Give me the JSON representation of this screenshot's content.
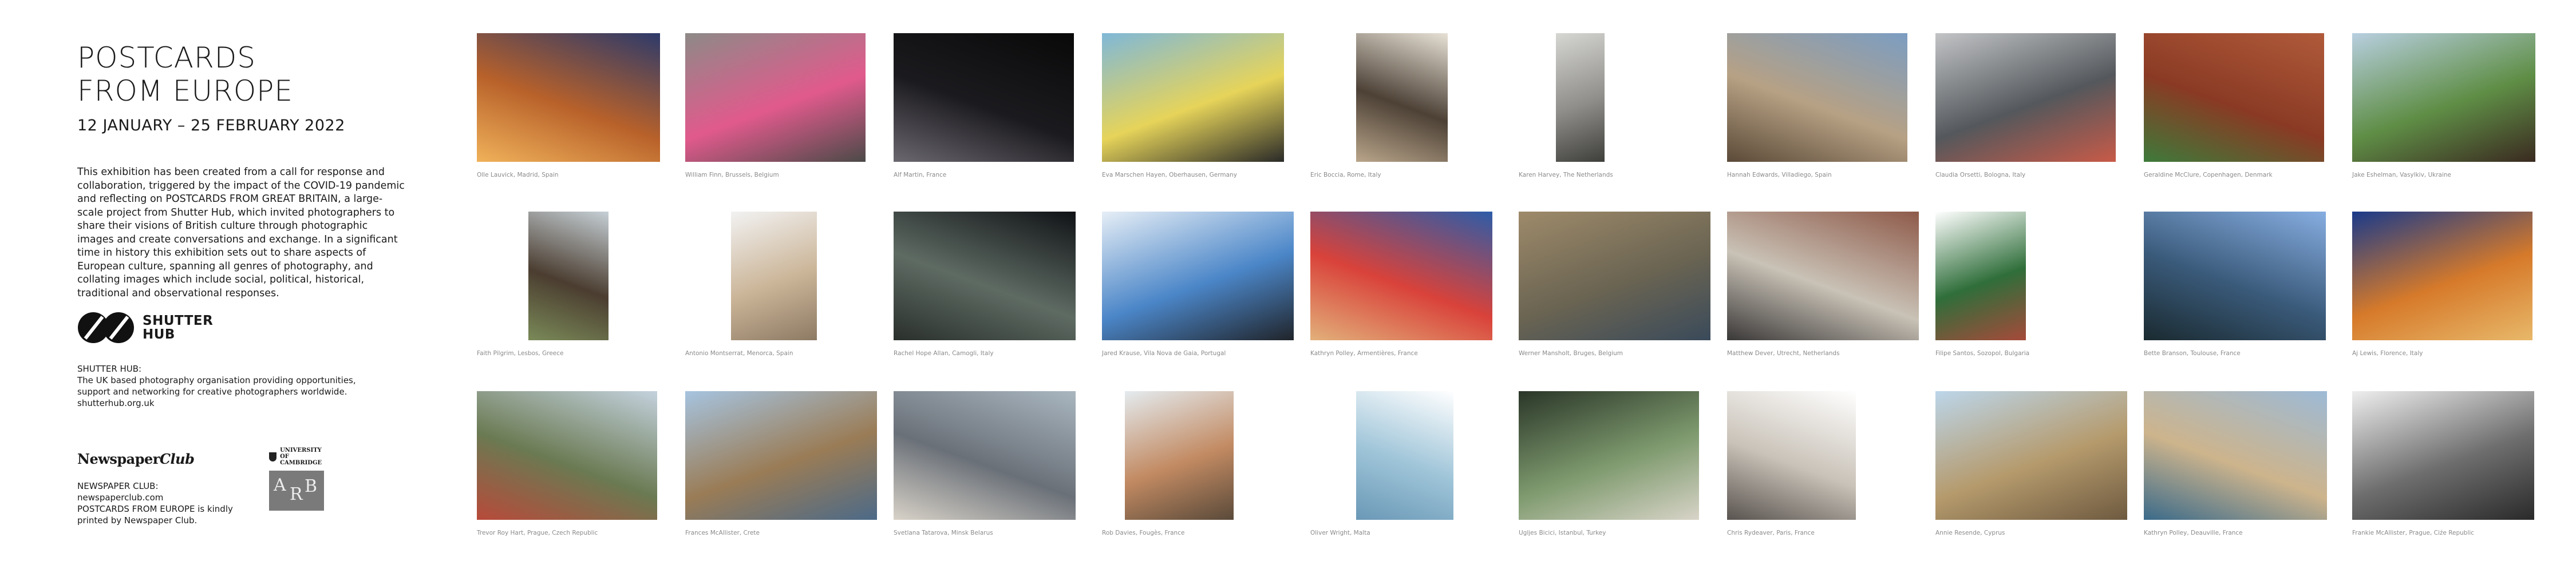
{
  "exhibition": {
    "title_line1": "POSTCARDS",
    "title_line2": "FROM EUROPE",
    "dates": "12 JANUARY – 25 FEBRUARY 2022",
    "intro": "This exhibition has been created from a call for response and collaboration, triggered by the impact of the COVID-19 pandemic and reflecting on POSTCARDS FROM GREAT BRITAIN, a large-scale project from Shutter Hub, which invited photographers to share their visions of British culture through photographic images and create conversations and exchange. In a significant time in history this exhibition sets out to share aspects of European culture, spanning all genres of photography, and collating images which include social, political, historical, traditional and observational responses."
  },
  "shutter_hub": {
    "logo_line1": "SHUTTER",
    "logo_line2": "HUB",
    "heading": "SHUTTER HUB:",
    "desc1": "The UK based photography organisation providing opportunities,",
    "desc2": "support and networking for creative photographers worldwide.",
    "url": "shutterhub.org.uk"
  },
  "newspaper_club": {
    "logo_a": "Newspaper",
    "logo_b": "Club",
    "heading": "NEWSPAPER CLUB:",
    "url": "newspaperclub.com",
    "credit1": "POSTCARDS FROM EUROPE is kindly",
    "credit2": "printed by Newspaper Club."
  },
  "cambridge": {
    "line1": "UNIVERSITY OF",
    "line2": "CAMBRIDGE",
    "arb_a": "A",
    "arb_r": "R",
    "arb_b": "B"
  },
  "photos": [
    {
      "caption": "Olle Lauvick, Madrid, Spain",
      "colors": [
        "#2d3a6a",
        "#b8612a",
        "#f0b25a"
      ]
    },
    {
      "caption": "William Finn, Brussels, Belgium",
      "colors": [
        "#8d8a88",
        "#e15a8c",
        "#4b4a48"
      ]
    },
    {
      "caption": "Alf Martin, France",
      "colors": [
        "#090909",
        "#1b1a1e",
        "#6b6870"
      ]
    },
    {
      "caption": "Eva Marschen Hayen, Oberhausen, Germany",
      "colors": [
        "#7fb8d8",
        "#e6d45a",
        "#2a2a28"
      ]
    },
    {
      "caption": "Eric Boccia, Rome, Italy",
      "colors": [
        "#e8e2d6",
        "#4d4136",
        "#b9a58a"
      ]
    },
    {
      "caption": "Karen Harvey, The Netherlands",
      "colors": [
        "#d6d6d2",
        "#8f8e8a",
        "#3e3e3b"
      ]
    },
    {
      "caption": "Hannah Edwards, Villadiego, Spain",
      "colors": [
        "#7b9dc2",
        "#b7a184",
        "#5b4a38"
      ]
    },
    {
      "caption": "Claudia Orsetti, Bologna, Italy",
      "colors": [
        "#c2c4c6",
        "#54585c",
        "#c85a48"
      ]
    },
    {
      "caption": "Geraldine McClure, Copenhagen, Denmark",
      "colors": [
        "#b05a3a",
        "#8a3a24",
        "#3e7a3a"
      ]
    },
    {
      "caption": "Jake Eshelman, Vasylkiv, Ukraine",
      "colors": [
        "#b8cfe0",
        "#5f8e46",
        "#3a2a20"
      ]
    },
    {
      "caption": "Faith Pilgrim, Lesbos, Greece",
      "colors": [
        "#c6d0d6",
        "#4b3d30",
        "#7a8a58"
      ]
    },
    {
      "caption": "Antonio Montserrat, Menorca, Spain",
      "colors": [
        "#f2f2f2",
        "#cbb598",
        "#8d7a64"
      ]
    },
    {
      "caption": "Rachel Hope Allan, Camogli, Italy",
      "colors": [
        "#101216",
        "#5e6b63",
        "#2a302c"
      ]
    },
    {
      "caption": "Jared Krause, Vila Nova de Gaia, Portugal",
      "colors": [
        "#e6eef6",
        "#4b86c8",
        "#20242a"
      ]
    },
    {
      "caption": "Kathryn Polley, Armentières, France",
      "colors": [
        "#2d5ca8",
        "#d9423a",
        "#e2b07a"
      ]
    },
    {
      "caption": "Werner Mansholt, Bruges, Belgium",
      "colors": [
        "#9e8a6a",
        "#6a6452",
        "#3a4a5a"
      ]
    },
    {
      "caption": "Matthew Dever, Utrecht, Netherlands",
      "colors": [
        "#8e5a4a",
        "#c9c2b6",
        "#3a3838"
      ]
    },
    {
      "caption": "Filipe Santos, Sozopol, Bulgaria",
      "colors": [
        "#ffffff",
        "#2f6e3a",
        "#a64a3a"
      ]
    },
    {
      "caption": "Bette Branson, Toulouse, France",
      "colors": [
        "#87aee2",
        "#3a5a7a",
        "#1a2a30"
      ]
    },
    {
      "caption": "Aj Lewis, Florence, Italy",
      "colors": [
        "#1a3a8a",
        "#d67a2a",
        "#e8b86a"
      ]
    },
    {
      "caption": "Trevor Roy Hart, Prague, Czech Republic",
      "colors": [
        "#c4d2de",
        "#6a7a52",
        "#b84a3a"
      ]
    },
    {
      "caption": "Frances McAllister, Crete",
      "colors": [
        "#a6c4e0",
        "#9a7c56",
        "#4c6a88"
      ]
    },
    {
      "caption": "Svetlana Tatarova, Minsk Belarus",
      "colors": [
        "#a9b6c0",
        "#6a7078",
        "#d8d2c8"
      ]
    },
    {
      "caption": "Rob Davies, Fougès, France",
      "colors": [
        "#e4ebef",
        "#c28a62",
        "#5a4a3a"
      ]
    },
    {
      "caption": "Oliver Wright, Malta",
      "colors": [
        "#ffffff",
        "#9ec4d8",
        "#6a98b6"
      ]
    },
    {
      "caption": "Ugljes Bicici, Istanbul, Turkey",
      "colors": [
        "#2a3628",
        "#7e9a6e",
        "#d8d4c8"
      ]
    },
    {
      "caption": "Chris Rydeaver, Paris, France",
      "colors": [
        "#ffffff",
        "#c9c2b8",
        "#5a5450"
      ]
    },
    {
      "caption": "Annie Resende, Cyprus",
      "colors": [
        "#bcd6ea",
        "#b59a6c",
        "#6e5a40"
      ]
    },
    {
      "caption": "Kathryn Polley, Deauville, France",
      "colors": [
        "#9dbad6",
        "#cdb48c",
        "#3a6a8a"
      ]
    },
    {
      "caption": "Frankie McAllister, Prague, Ciźe Republic",
      "colors": [
        "#eeeeee",
        "#6e6e6e",
        "#2a2a2a"
      ]
    }
  ]
}
